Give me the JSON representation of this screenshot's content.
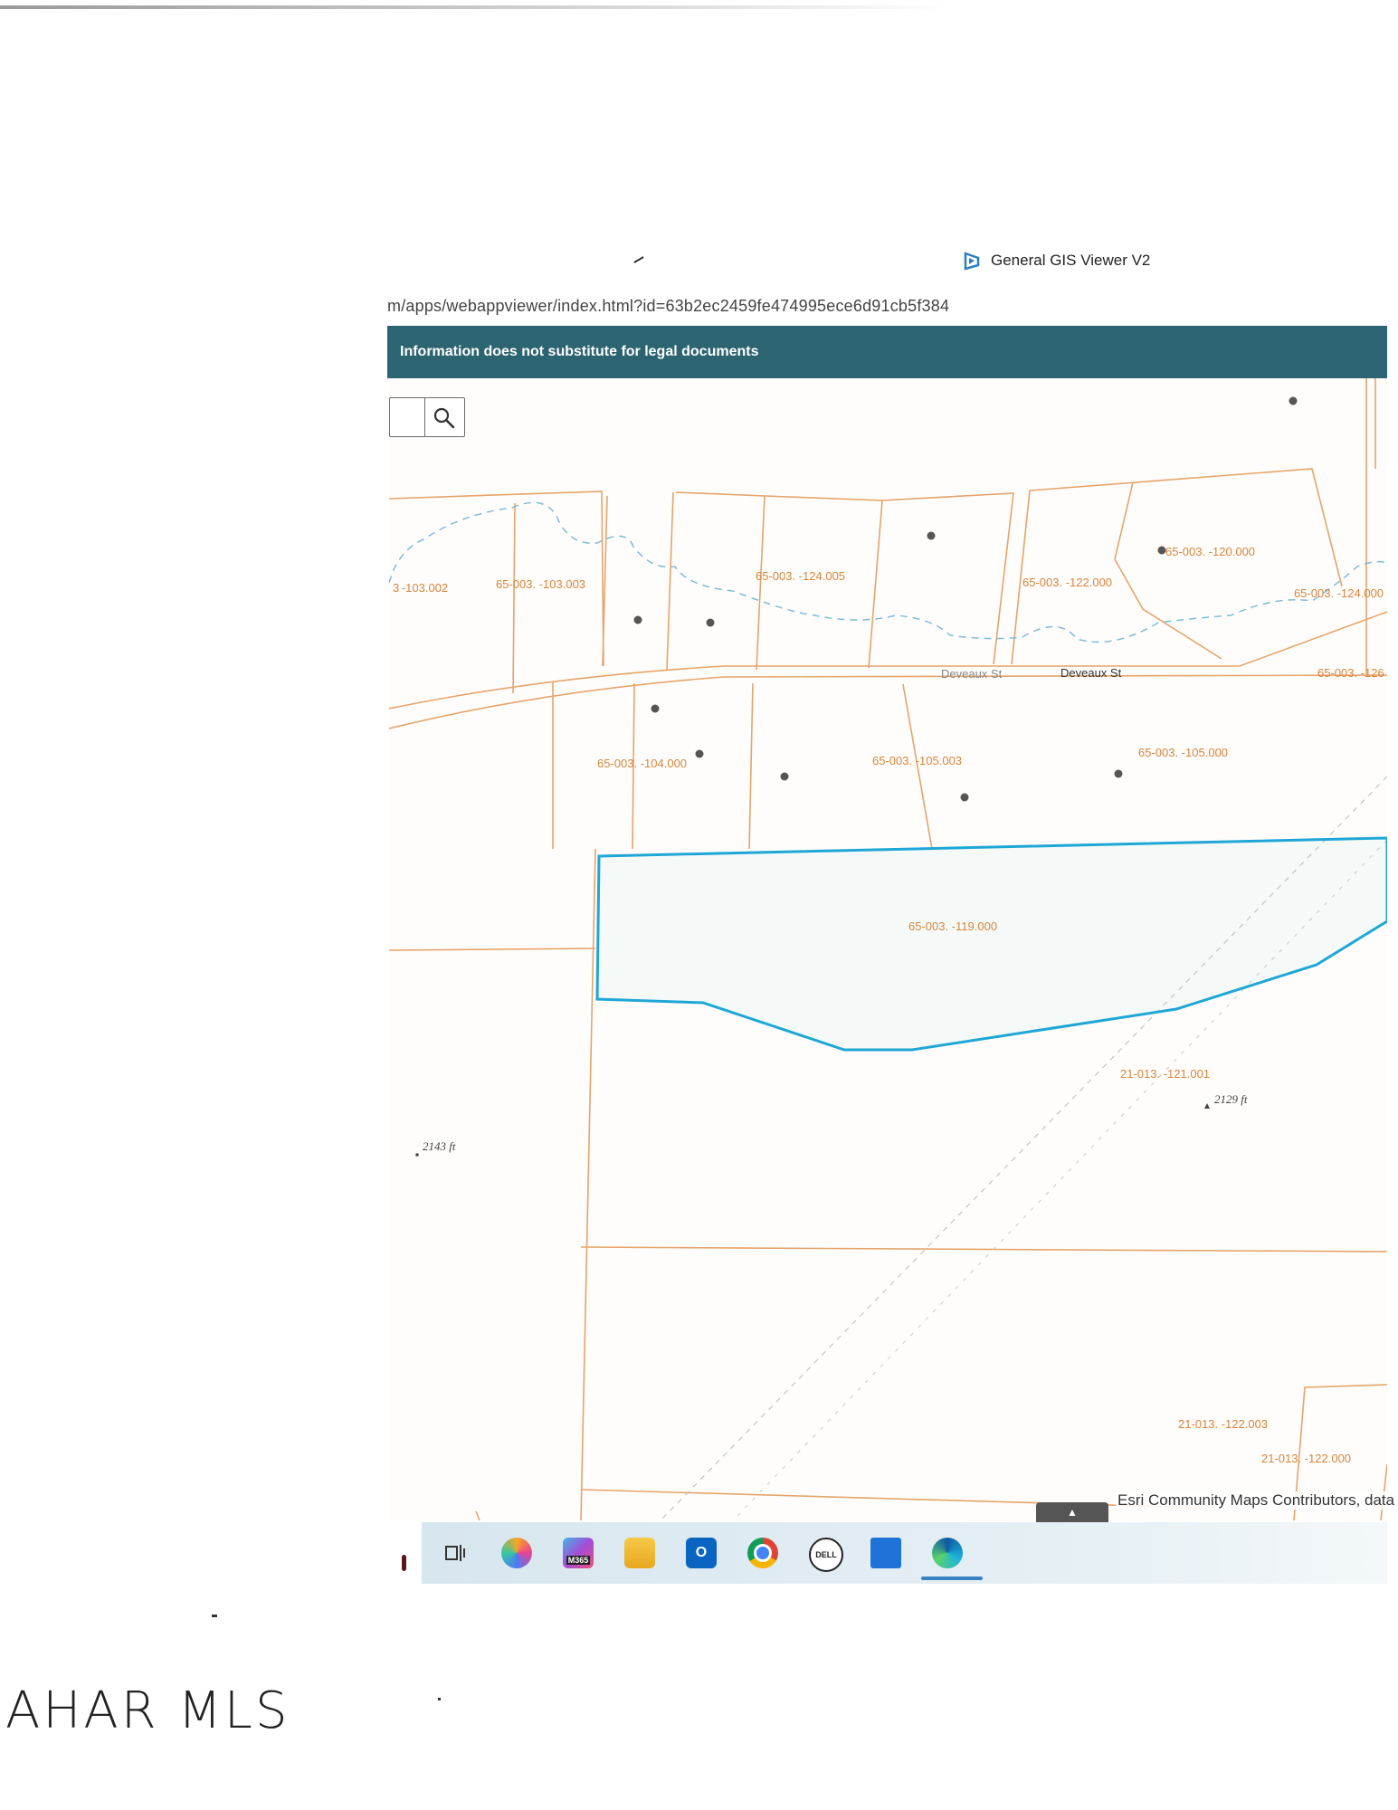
{
  "app": {
    "title": "General GIS Viewer V2",
    "url": "m/apps/webappviewer/index.html?id=63b2ec2459fe474995ece6d91cb5f384",
    "banner": "Information does not substitute for legal documents"
  },
  "map": {
    "search_icon": "search-icon",
    "street_labels": [
      "Deveaux St",
      "Deveaux St"
    ],
    "parcel_labels": [
      "3 -103.002",
      "65-003. -103.003",
      "65-003. -124.005",
      "65-003. -122.000",
      "65-003. -120.000",
      "65-003. -124.000",
      "65-003. -126",
      "65-003. -104.000",
      "65-003. -105.003",
      "65-003. -105.000",
      "65-003. -119.000",
      "21-013. -121.001",
      "21-013. -122.003",
      "21-013. -122.000"
    ],
    "elevation_labels": [
      "2143 ft",
      "2129 ft"
    ],
    "attribution": "Esri Community Maps Contributors, data",
    "colors": {
      "parcel_line": "#e6a46a",
      "parcel_label": "#d9853b",
      "selected_parcel": "#1ea7d6",
      "stream": "#7fbcd6",
      "banner": "#2c6571"
    }
  },
  "taskbar": {
    "icons": [
      "task-view-icon",
      "copilot-icon",
      "m365-icon",
      "file-explorer-icon",
      "outlook-icon",
      "chrome-icon",
      "dell-icon",
      "app-icon",
      "edge-icon"
    ],
    "m365_label": "M365",
    "dell_label": "DELL"
  },
  "watermark": "AHAR MLS"
}
